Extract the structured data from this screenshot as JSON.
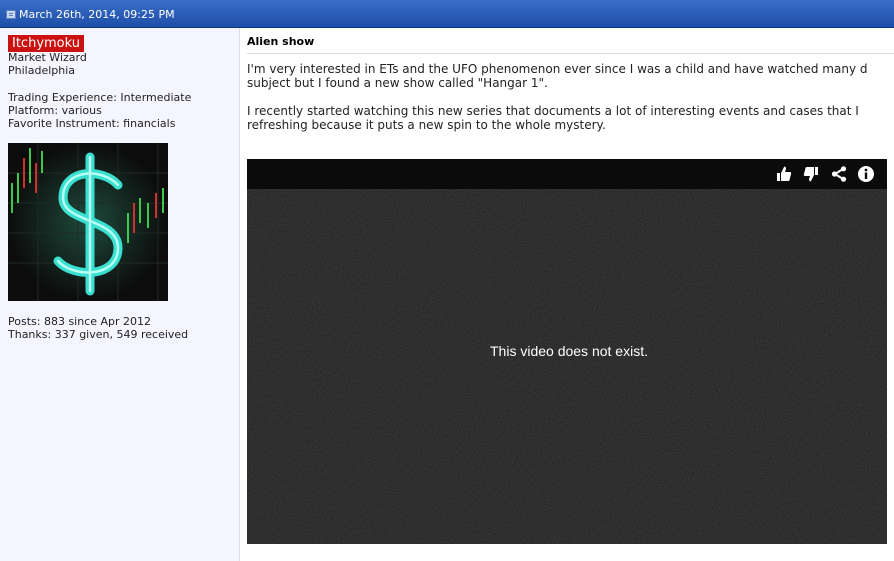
{
  "header": {
    "date": "March 26th, 2014, 09:25 PM"
  },
  "user": {
    "name": "Itchymoku",
    "rank": "Market Wizard",
    "location": "Philadelphia",
    "experience": "Trading Experience: Intermediate",
    "platform": "Platform: various",
    "instrument": "Favorite Instrument: financials",
    "posts": "Posts: 883 since Apr 2012",
    "thanks": "Thanks: 337 given, 549 received"
  },
  "post": {
    "title": "Alien show",
    "para1_line1": "I'm very interested in ETs and the UFO phenomenon ever since I was a child and have watched many d",
    "para1_line2": "subject but I found a new show called \"Hangar 1\".",
    "para2_line1": "I recently started watching this new series that documents a lot of interesting events and cases that I",
    "para2_line2": "refreshing because it puts a new spin to the whole mystery."
  },
  "video": {
    "message": "This video does not exist.",
    "controls": [
      "thumbs-up-icon",
      "thumbs-down-icon",
      "share-icon",
      "info-icon"
    ]
  },
  "colors": {
    "header_bar": "#2a5bb8",
    "username_badge": "#cc1111",
    "user_pane": "#f5f5ff"
  }
}
